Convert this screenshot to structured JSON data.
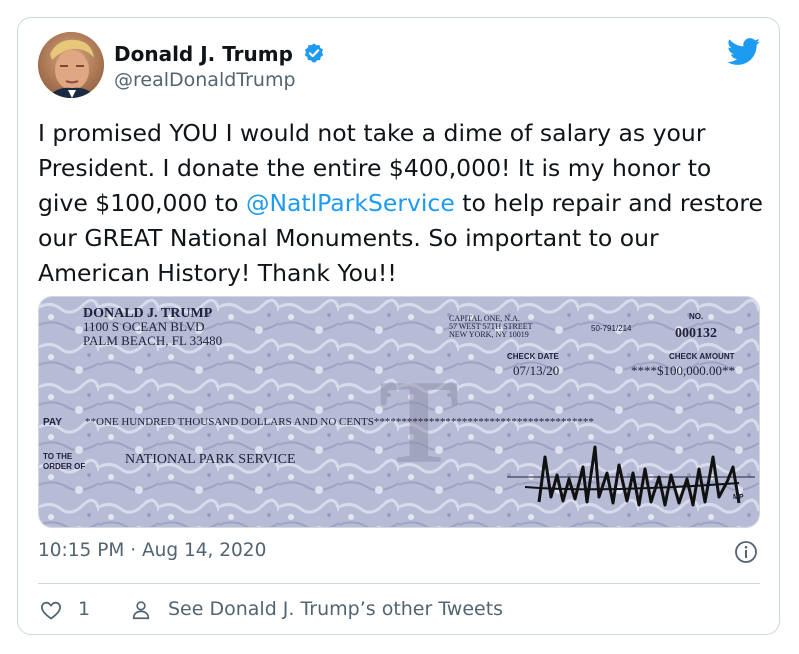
{
  "user": {
    "display_name": "Donald J. Trump",
    "handle": "@realDonaldTrump",
    "verified": true
  },
  "tweet": {
    "text_before_mention": "I promised YOU I would not take a dime of salary as your President. I donate the entire $400,000! It is my honor to give $100,000 to ",
    "mention": "@NatlParkService",
    "text_after_mention": " to help repair and restore our GREAT National Monuments. So important to our American History! Thank You!!",
    "time": "10:15 PM · Aug 14, 2020",
    "like_count": "1",
    "see_other_link": "See Donald J. Trump’s other Tweets"
  },
  "check_image": {
    "payer_name": "DONALD J. TRUMP",
    "payer_address1": "1100 S OCEAN BLVD",
    "payer_address2": "PALM BEACH, FL 33480",
    "bank_line1": "CAPITAL ONE, N.A.",
    "bank_line2": "57 WEST 57TH STREET",
    "bank_line3": "NEW YORK, NY 10019",
    "routing": "50-791/214",
    "number_label": "NO.",
    "check_number": "000132",
    "date_label": "CHECK DATE",
    "date": "07/13/20",
    "amount_label": "CHECK AMOUNT",
    "amount": "****$100,000.00**",
    "pay_label": "PAY",
    "pay_words": "**ONE HUNDRED THOUSAND DOLLARS AND NO CENTS****************************************",
    "order_label_1": "TO THE",
    "order_label_2": "ORDER OF",
    "payee": "NATIONAL PARK SERVICE",
    "watermark_letter": "T",
    "mp_mark": "MP"
  },
  "colors": {
    "link": "#1d9bf0",
    "secondary_text": "#536471",
    "border": "#cfd9de",
    "check_bg": "#b9bdd6"
  }
}
